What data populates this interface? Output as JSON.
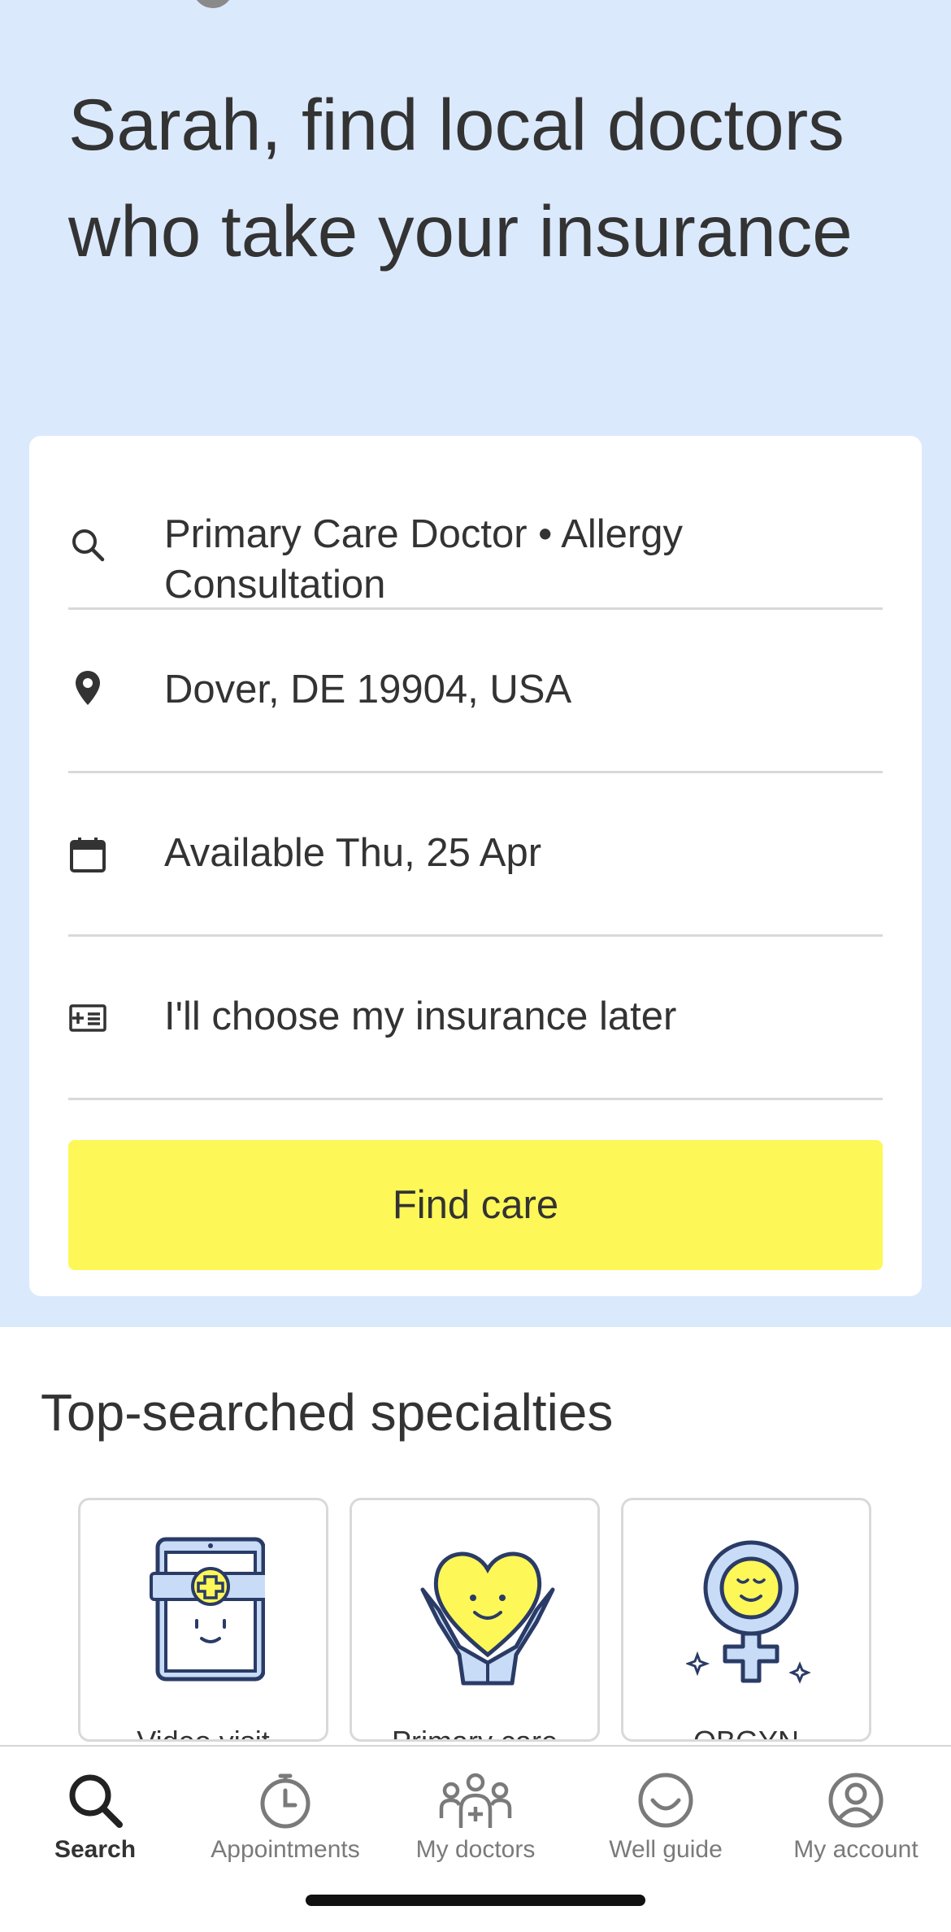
{
  "headline": "Sarah, find local doctors who take your insurance",
  "search": {
    "query": "Primary Care Doctor • Allergy Consultation",
    "location": "Dover, DE 19904, USA",
    "availability": "Available Thu, 25 Apr",
    "insurance": "I'll choose my insurance later",
    "button_label": "Find care"
  },
  "specialties": {
    "title": "Top-searched specialties",
    "items": [
      {
        "label": "Video visit",
        "icon": "video-visit-icon"
      },
      {
        "label": "Primary care",
        "icon": "primary-care-heart-icon"
      },
      {
        "label": "OBGYN",
        "icon": "obgyn-icon"
      }
    ]
  },
  "tabbar": {
    "items": [
      {
        "label": "Search",
        "icon": "search-icon",
        "active": true
      },
      {
        "label": "Appointments",
        "icon": "stopwatch-icon",
        "active": false
      },
      {
        "label": "My doctors",
        "icon": "people-icon",
        "active": false
      },
      {
        "label": "Well guide",
        "icon": "smile-icon",
        "active": false
      },
      {
        "label": "My account",
        "icon": "account-icon",
        "active": false
      }
    ]
  },
  "colors": {
    "hero_bg": "#dbe9fd",
    "button_bg": "#fef758",
    "illustration_blue": "#c9dcf7",
    "illustration_yellow": "#fef758",
    "text": "#333333"
  }
}
